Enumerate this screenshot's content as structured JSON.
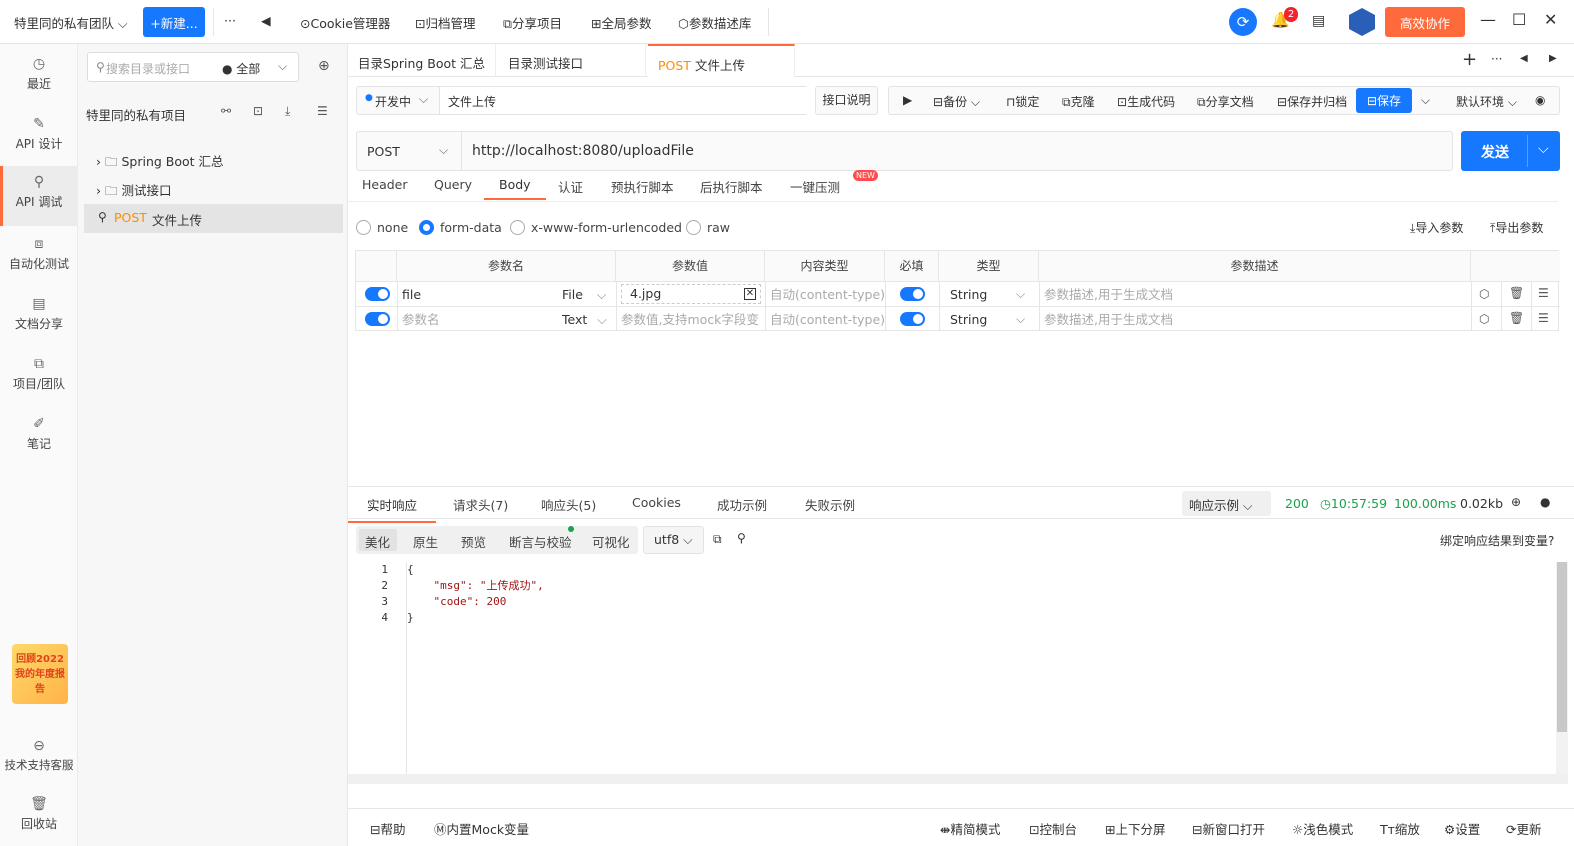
{
  "topbar": {
    "team": "特里同的私有团队 ⌵",
    "new_button": "+新建...",
    "more": "···",
    "back": "◀",
    "items": [
      "Cookie管理器",
      "归档管理",
      "分享项目",
      "全局参数",
      "参数描述库"
    ],
    "notification_count": "2",
    "collab_button": "高效协作"
  },
  "rail": {
    "items": [
      "最近",
      "API 设计",
      "API 调试",
      "自动化测试",
      "文档分享",
      "项目/团队",
      "笔记"
    ],
    "promo": "回顾2022 我的年度报告",
    "support": "技术支持客服",
    "trash": "回收站"
  },
  "tree": {
    "search_placeholder": "搜索目录或接口",
    "filter": "全部",
    "project": "特里同的私有项目",
    "folders": [
      "Spring Boot 汇总",
      "测试接口"
    ],
    "api_method": "POST",
    "api_name": "文件上传"
  },
  "tabs": [
    {
      "label": "目录Spring Boot 汇总"
    },
    {
      "label": "目录测试接口"
    },
    {
      "method": "POST",
      "label": "文件上传"
    }
  ],
  "toolbar": {
    "status": "开发中",
    "api_name": "文件上传",
    "doc_button": "接口说明",
    "backup": "备份",
    "lock": "锁定",
    "clone": "克隆",
    "gen_code": "生成代码",
    "share_doc": "分享文档",
    "save_archive": "保存并归档",
    "save": "保存",
    "env": "默认环境"
  },
  "request": {
    "method": "POST",
    "url": "http://localhost:8080/uploadFile",
    "send": "发送"
  },
  "subtabs": [
    "Header",
    "Query",
    "Body",
    "认证",
    "预执行脚本",
    "后执行脚本",
    "一键压测"
  ],
  "new_badge": "NEW",
  "body_types": [
    "none",
    "form-data",
    "x-www-form-urlencoded",
    "raw"
  ],
  "import_params": "导入参数",
  "export_params": "导出参数",
  "params_table": {
    "headers": [
      "参数名",
      "参数值",
      "内容类型",
      "必填",
      "类型",
      "参数描述"
    ],
    "rows": [
      {
        "name": "file",
        "ftype": "File",
        "value": "4.jpg",
        "content_type": "自动(content-type)",
        "type": "String",
        "desc": "参数描述,用于生成文档"
      },
      {
        "name": "参数名",
        "ftype": "Text",
        "value": "参数值,支持mock字段变",
        "content_type": "自动(content-type)",
        "type": "String",
        "desc": "参数描述,用于生成文档"
      }
    ]
  },
  "response": {
    "tabs": [
      "实时响应",
      "请求头(7)",
      "响应头(5)",
      "Cookies",
      "成功示例",
      "失败示例"
    ],
    "example": "响应示例",
    "status": "200",
    "time": "10:57:59",
    "duration": "100.00ms",
    "size": "0.02kb",
    "formats": [
      "美化",
      "原生",
      "预览",
      "断言与校验",
      "可视化"
    ],
    "encoding": "utf8",
    "bind_var": "绑定响应结果到变量?",
    "lines": [
      "{",
      "    \"msg\": \"上传成功\",",
      "    \"code\": 200",
      "}"
    ],
    "line_numbers": [
      "1",
      "2",
      "3",
      "4"
    ]
  },
  "bottombar": {
    "help": "帮助",
    "mock": "内置Mock变量",
    "items": [
      "精简模式",
      "控制台",
      "上下分屏",
      "新窗口打开",
      "浅色模式",
      "缩放",
      "设置",
      "更新"
    ]
  },
  "colors": {
    "accent": "#1677ff",
    "brand": "#ff6a3d",
    "post": "#ff8c00",
    "success": "#19a34a"
  }
}
